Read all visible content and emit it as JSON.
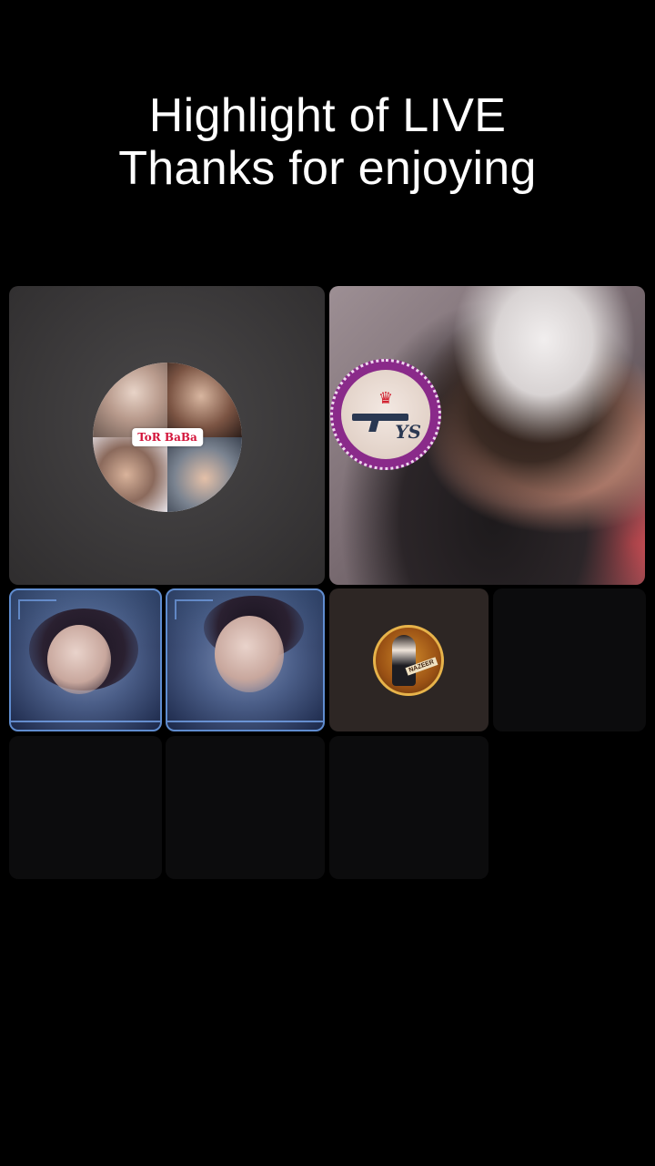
{
  "headline": {
    "line1": "Highlight of LIVE",
    "line2": "Thanks for enjoying"
  },
  "grid": {
    "host_tile": {
      "avatar_label": "ToR BaBa"
    },
    "guest_tile": {
      "badge_text": "YS"
    },
    "coin_tile": {
      "badge_text": "NAZEER"
    }
  },
  "colors": {
    "background": "#000000",
    "text": "#ffffff",
    "tile_empty": "#0d0d0e",
    "host_tile": "#3a3839",
    "badge_ring": "#8a2a8a",
    "avatar_label_text": "#d3143a"
  }
}
